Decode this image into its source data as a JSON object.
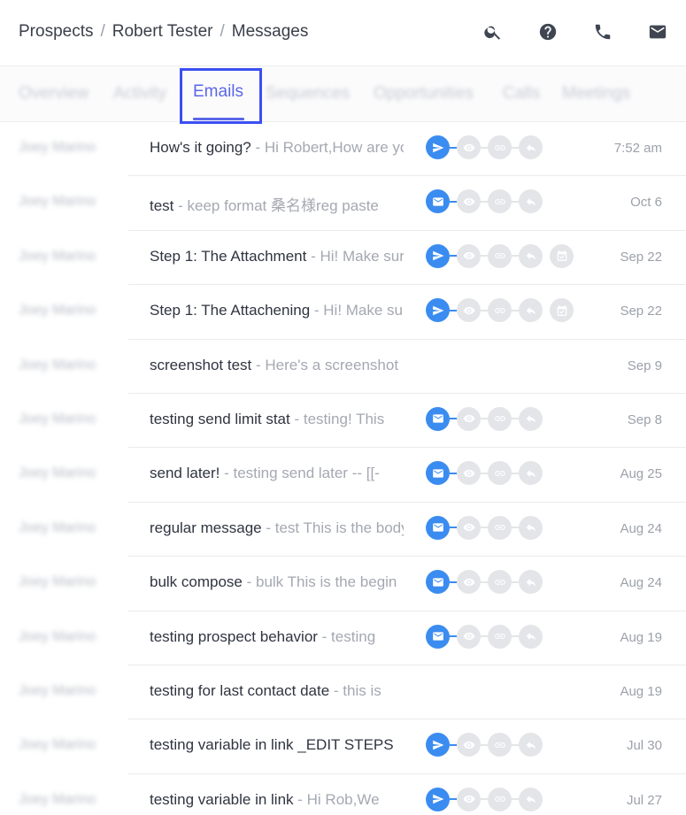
{
  "breadcrumb": [
    "Prospects",
    "Robert Tester",
    "Messages"
  ],
  "header_icons": [
    "search-icon",
    "help-icon",
    "phone-icon",
    "mail-icon"
  ],
  "tabs": [
    {
      "label": "Overview",
      "blurred": true
    },
    {
      "label": "Activity",
      "blurred": true
    },
    {
      "label": "Emails",
      "active": true
    },
    {
      "label": "Sequences",
      "blurred": true
    },
    {
      "label": "Opportunities",
      "blurred": true
    },
    {
      "label": "Calls",
      "blurred": true
    },
    {
      "label": "Meetings",
      "blurred": true
    }
  ],
  "colors": {
    "accent": "#5a67e8",
    "focus": "#3b4ff0",
    "status_on": "#3b8cf0",
    "status_off": "#e4e5e8"
  },
  "messages": [
    {
      "sender": "Joey Marino",
      "subject": "How's it going?",
      "preview": " - Hi Robert,How are you doing",
      "date": "7:52 am",
      "status": "sent",
      "extra": false
    },
    {
      "sender": "Joey Marino",
      "subject": "test",
      "preview": " - keep format 桑名様reg paste",
      "date": "Oct 6",
      "status": "mail",
      "extra": false
    },
    {
      "sender": "Joey Marino",
      "subject": "Step 1: The Attachment",
      "preview": " - Hi! Make sure",
      "date": "Sep 22",
      "status": "sent",
      "extra": true
    },
    {
      "sender": "Joey Marino",
      "subject": "Step 1: The Attachening",
      "preview": " - Hi! Make sure",
      "date": "Sep 22",
      "status": "sent",
      "extra": true
    },
    {
      "sender": "Joey Marino",
      "subject": "screenshot test",
      "preview": " - Here's a screenshot",
      "date": "Sep 9",
      "status": "none",
      "extra": false
    },
    {
      "sender": "Joey Marino",
      "subject": "testing send limit stat",
      "preview": " - testing! This",
      "date": "Sep 8",
      "status": "mail",
      "extra": false
    },
    {
      "sender": "Joey Marino",
      "subject": "send later!",
      "preview": " - testing send later -- [[-",
      "date": "Aug 25",
      "status": "mail",
      "extra": false
    },
    {
      "sender": "Joey Marino",
      "subject": "regular message",
      "preview": " - test This is the body",
      "date": "Aug 24",
      "status": "mail",
      "extra": false
    },
    {
      "sender": "Joey Marino",
      "subject": "bulk compose",
      "preview": " - bulk This is the begin",
      "date": "Aug 24",
      "status": "mail",
      "extra": false
    },
    {
      "sender": "Joey Marino",
      "subject": "testing prospect behavior",
      "preview": " - testing",
      "date": "Aug 19",
      "status": "mail",
      "extra": false
    },
    {
      "sender": "Joey Marino",
      "subject": "testing for last contact date",
      "preview": " - this is",
      "date": "Aug 19",
      "status": "none",
      "extra": false
    },
    {
      "sender": "Joey Marino",
      "subject": "testing variable in link _EDIT STEPS",
      "preview": "",
      "date": "Jul 30",
      "status": "sent",
      "extra": false
    },
    {
      "sender": "Joey Marino",
      "subject": "testing variable in link",
      "preview": " - Hi Rob,We",
      "date": "Jul 27",
      "status": "sent",
      "extra": false
    }
  ]
}
